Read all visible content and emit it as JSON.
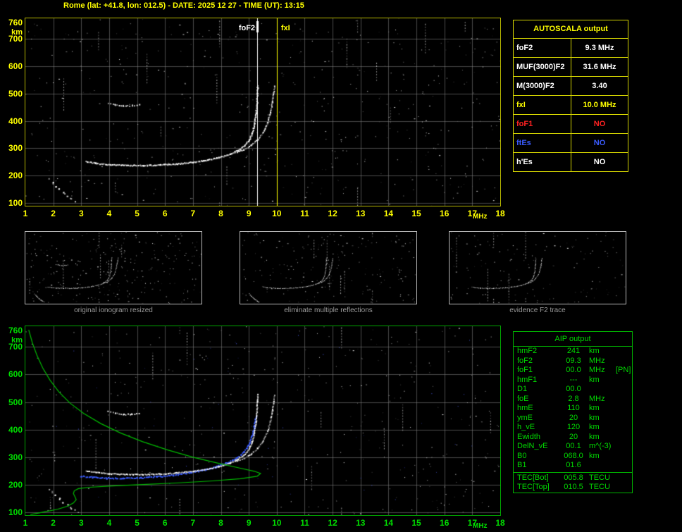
{
  "header": {
    "title": "Rome (lat: +41.8, lon: 012.5) - DATE: 2025 12 27 - TIME (UT): 13:15"
  },
  "colors": {
    "accent_yellow": "#ffff00",
    "accent_green": "#00d800",
    "marker_white": "#ffffff",
    "status_red": "#ff2222",
    "status_blue": "#3a5cff",
    "caption_gray": "#9a9a9a"
  },
  "axes": {
    "x_ticks": [
      "1",
      "2",
      "3",
      "4",
      "5",
      "6",
      "7",
      "8",
      "9",
      "10",
      "11",
      "12",
      "13",
      "14",
      "15",
      "16",
      "17",
      "18"
    ],
    "x_unit": "MHz",
    "y_ticks": [
      {
        "label": "760",
        "km": 760
      },
      {
        "label": "700",
        "km": 700
      },
      {
        "label": "600",
        "km": 600
      },
      {
        "label": "500",
        "km": 500
      },
      {
        "label": "400",
        "km": 400
      },
      {
        "label": "300",
        "km": 300
      },
      {
        "label": "200",
        "km": 200
      },
      {
        "label": "100",
        "km": 100
      }
    ],
    "y_unit": "km"
  },
  "top_plot": {
    "foF2_label": "foF2",
    "fxI_label": "fxI"
  },
  "autoscala_table": {
    "title": "AUTOSCALA output",
    "rows": [
      {
        "label": "foF2",
        "value": "9.3 MHz",
        "color": "#ffffff"
      },
      {
        "label": "MUF(3000)F2",
        "value": "31.6 MHz",
        "color": "#ffffff"
      },
      {
        "label": "M(3000)F2",
        "value": "3.40",
        "color": "#ffffff"
      },
      {
        "label": "fxI",
        "value": "10.0 MHz",
        "color": "#ffff00"
      },
      {
        "label": "foF1",
        "value": "NO",
        "color": "#ff2222"
      },
      {
        "label": "ftEs",
        "value": "NO",
        "color": "#3a5cff"
      },
      {
        "label": "h'Es",
        "value": "NO",
        "color": "#ffffff"
      }
    ]
  },
  "thumbnails": [
    {
      "caption": "original ionogram resized"
    },
    {
      "caption": "eliminate multiple reflections"
    },
    {
      "caption": "evidence F2 trace"
    }
  ],
  "aip_table": {
    "title": "AIP output",
    "rows": [
      {
        "label": "hmF2",
        "value": "241",
        "unit": "km",
        "note": ""
      },
      {
        "label": "foF2",
        "value": "09.3",
        "unit": "MHz",
        "note": ""
      },
      {
        "label": "foF1",
        "value": "00.0",
        "unit": "MHz",
        "note": "[PN]"
      },
      {
        "label": "hmF1",
        "value": "---",
        "unit": "km",
        "note": ""
      },
      {
        "label": "D1",
        "value": "00.0",
        "unit": "",
        "note": ""
      },
      {
        "label": "foE",
        "value": "2.8",
        "unit": "MHz",
        "note": ""
      },
      {
        "label": "hmE",
        "value": "110",
        "unit": "km",
        "note": ""
      },
      {
        "label": "ymE",
        "value": "20",
        "unit": "km",
        "note": ""
      },
      {
        "label": "h_vE",
        "value": "120",
        "unit": "km",
        "note": ""
      },
      {
        "label": "Ewidth",
        "value": "20",
        "unit": "km",
        "note": ""
      },
      {
        "label": "DelN_vE",
        "value": "00.1",
        "unit": "m^(-3)",
        "note": ""
      },
      {
        "label": "B0",
        "value": "068.0",
        "unit": "km",
        "note": ""
      },
      {
        "label": "B1",
        "value": "01.6",
        "unit": "",
        "note": ""
      }
    ],
    "tec_rows": [
      {
        "label": "TEC[Bot]",
        "value": "005.8",
        "unit": "TECU",
        "note": ""
      },
      {
        "label": "TEC[Top]",
        "value": "010.5",
        "unit": "TECU",
        "note": ""
      }
    ]
  },
  "chart_data": {
    "type": "scatter",
    "title": "Ionogram with AUTOSCALA interpretation",
    "x_axis": {
      "label": "MHz",
      "range": [
        1,
        18
      ]
    },
    "y_axis": {
      "label": "km",
      "range": [
        90,
        775
      ]
    },
    "foF2_mhz": 9.3,
    "fxI_mhz": 10.0,
    "hmF2_km": 241,
    "f2_o_trace": [
      [
        3.15,
        253
      ],
      [
        3.5,
        247
      ],
      [
        4.0,
        242
      ],
      [
        4.6,
        240
      ],
      [
        5.2,
        239
      ],
      [
        5.8,
        241
      ],
      [
        6.4,
        245
      ],
      [
        7.0,
        251
      ],
      [
        7.5,
        259
      ],
      [
        7.9,
        268
      ],
      [
        8.3,
        280
      ],
      [
        8.6,
        295
      ],
      [
        8.85,
        313
      ],
      [
        9.0,
        333
      ],
      [
        9.1,
        357
      ],
      [
        9.18,
        390
      ],
      [
        9.24,
        430
      ],
      [
        9.27,
        468
      ],
      [
        9.29,
        505
      ],
      [
        9.3,
        530
      ]
    ],
    "f2_x_trace": [
      [
        8.5,
        287
      ],
      [
        8.8,
        297
      ],
      [
        9.05,
        312
      ],
      [
        9.3,
        334
      ],
      [
        9.5,
        362
      ],
      [
        9.65,
        396
      ],
      [
        9.75,
        432
      ],
      [
        9.82,
        470
      ],
      [
        9.87,
        505
      ],
      [
        9.9,
        528
      ]
    ],
    "second_hop": [
      [
        3.95,
        468
      ],
      [
        4.2,
        461
      ],
      [
        4.5,
        457
      ],
      [
        4.8,
        458
      ],
      [
        5.05,
        462
      ]
    ],
    "e_scatter": [
      [
        1.85,
        188
      ],
      [
        1.95,
        176
      ],
      [
        2.05,
        164
      ],
      [
        2.18,
        152
      ],
      [
        2.32,
        140
      ],
      [
        2.48,
        128
      ],
      [
        2.62,
        117
      ],
      [
        2.78,
        108
      ]
    ],
    "blue_trace": [
      [
        2.95,
        233
      ],
      [
        3.4,
        229
      ],
      [
        3.9,
        226
      ],
      [
        4.5,
        225
      ],
      [
        5.1,
        227
      ],
      [
        5.7,
        231
      ],
      [
        6.3,
        237
      ],
      [
        6.9,
        246
      ],
      [
        7.4,
        256
      ],
      [
        7.8,
        267
      ],
      [
        8.2,
        281
      ],
      [
        8.55,
        299
      ],
      [
        8.8,
        320
      ],
      [
        8.98,
        348
      ],
      [
        9.1,
        380
      ],
      [
        9.18,
        414
      ],
      [
        9.23,
        448
      ]
    ],
    "profile_green": [
      [
        1.12,
        762
      ],
      [
        1.25,
        715
      ],
      [
        1.42,
        668
      ],
      [
        1.62,
        624
      ],
      [
        1.88,
        580
      ],
      [
        2.2,
        537
      ],
      [
        2.6,
        496
      ],
      [
        3.1,
        458
      ],
      [
        3.7,
        422
      ],
      [
        4.4,
        388
      ],
      [
        5.2,
        356
      ],
      [
        6.1,
        326
      ],
      [
        7.0,
        300
      ],
      [
        7.9,
        278
      ],
      [
        8.7,
        260
      ],
      [
        9.2,
        249
      ],
      [
        9.42,
        241
      ],
      [
        9.3,
        231
      ],
      [
        8.7,
        222
      ],
      [
        7.7,
        214
      ],
      [
        6.5,
        207
      ],
      [
        5.2,
        201
      ],
      [
        4.1,
        196
      ],
      [
        3.3,
        191
      ],
      [
        2.9,
        186
      ],
      [
        2.75,
        178
      ],
      [
        2.72,
        168
      ],
      [
        2.78,
        156
      ],
      [
        2.82,
        146
      ],
      [
        2.72,
        134
      ],
      [
        2.5,
        122
      ],
      [
        2.15,
        111
      ],
      [
        1.75,
        103
      ],
      [
        1.4,
        96
      ],
      [
        1.18,
        92
      ]
    ]
  }
}
